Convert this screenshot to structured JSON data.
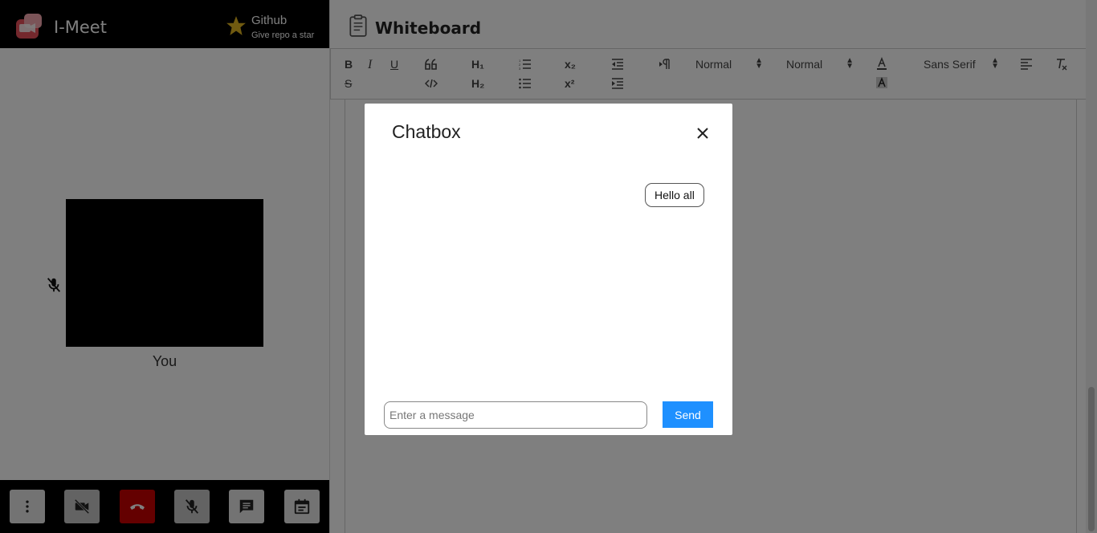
{
  "app": {
    "name": "I-Meet",
    "github_title": "Github",
    "github_subtitle": "Give repo a star"
  },
  "video": {
    "participant_label": "You"
  },
  "controls": [
    {
      "name": "more-options",
      "icon": "more-vert-icon"
    },
    {
      "name": "toggle-camera",
      "icon": "video-off-icon"
    },
    {
      "name": "end-call",
      "icon": "hang-up-icon"
    },
    {
      "name": "toggle-mic",
      "icon": "mic-off-icon"
    },
    {
      "name": "open-chat",
      "icon": "chat-icon"
    },
    {
      "name": "open-whiteboard",
      "icon": "calendar-icon"
    }
  ],
  "whiteboard": {
    "title": "Whiteboard",
    "toolbar": {
      "bold": "B",
      "italic": "I",
      "underline": "U",
      "strike": "S",
      "h1": "H₁",
      "h2": "H₂",
      "subscript": "x₂",
      "superscript": "x²",
      "size_value": "Normal",
      "header_value": "Normal",
      "font_value": "Sans Serif"
    }
  },
  "chatbox": {
    "title": "Chatbox",
    "messages": [
      "Hello all"
    ],
    "input_placeholder": "Enter a message",
    "send_label": "Send"
  },
  "colors": {
    "send_button": "#1e90ff",
    "end_call": "#c80000",
    "topbar": "#000000"
  }
}
